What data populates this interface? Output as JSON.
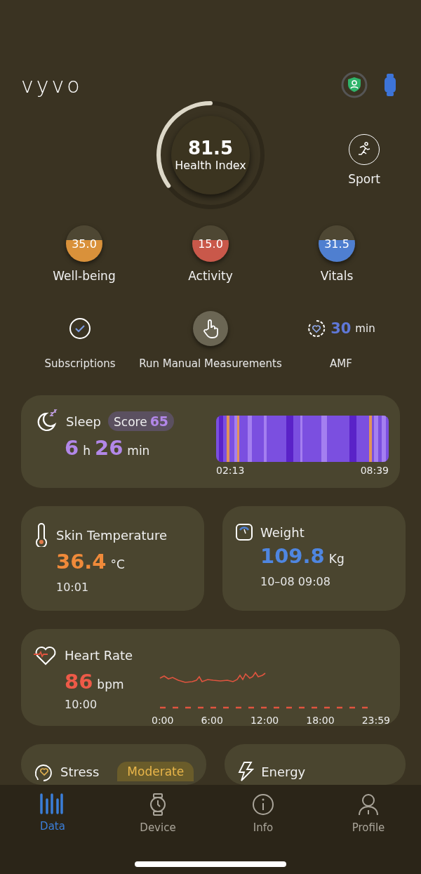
{
  "header": {
    "logo": "vyvo"
  },
  "health_index": {
    "value": "81.5",
    "label": "Health Index",
    "level": 0.35
  },
  "sport": {
    "label": "Sport"
  },
  "scores": [
    {
      "value": "35.0",
      "label": "Well-being",
      "color": "#d9913a"
    },
    {
      "value": "15.0",
      "label": "Activity",
      "color": "#c9584a"
    },
    {
      "value": "31.5",
      "label": "Vitals",
      "color": "#4f7fd0"
    }
  ],
  "actions": [
    {
      "kind": "subscriptions",
      "label": "Subscriptions"
    },
    {
      "kind": "manual",
      "label": "Run Manual Measurements"
    },
    {
      "kind": "amf",
      "value": "30",
      "unit": "min",
      "label": "AMF"
    }
  ],
  "sleep": {
    "title": "Sleep",
    "score_label": "Score",
    "score": "65",
    "hours": "6",
    "hours_unit": "h",
    "minutes": "26",
    "minutes_unit": "min",
    "start": "02:13",
    "end": "08:39"
  },
  "skin_temperature": {
    "title": "Skin Temperature",
    "value": "36.4",
    "unit": "°C",
    "time": "10:01"
  },
  "weight": {
    "title": "Weight",
    "value": "109.8",
    "unit": "Kg",
    "time": "10–08 09:08"
  },
  "heart_rate": {
    "title": "Heart Rate",
    "value": "86",
    "unit": "bpm",
    "time": "10:00",
    "x_labels": [
      "0:00",
      "6:00",
      "12:00",
      "18:00",
      "23:59"
    ]
  },
  "stress": {
    "title": "Stress",
    "badge": "Moderate"
  },
  "energy": {
    "title": "Energy"
  },
  "tabs": [
    {
      "label": "Data",
      "selected": true
    },
    {
      "label": "Device",
      "selected": false
    },
    {
      "label": "Info",
      "selected": false
    },
    {
      "label": "Profile",
      "selected": false
    }
  ]
}
